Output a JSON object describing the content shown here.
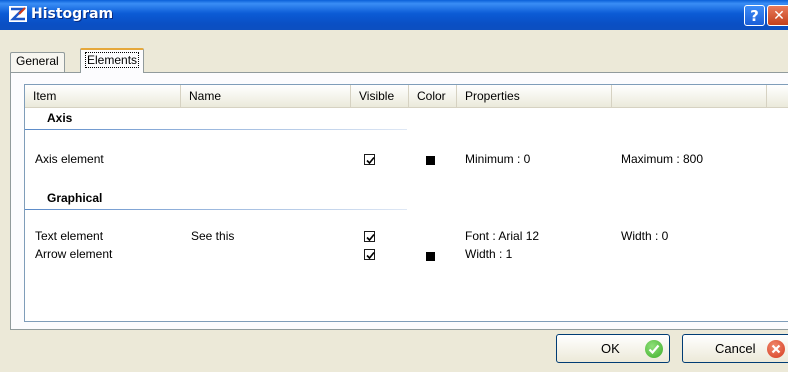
{
  "window": {
    "title": "Histogram"
  },
  "tabs": [
    {
      "label": "General"
    },
    {
      "label": "Elements"
    }
  ],
  "columns": [
    "Item",
    "Name",
    "Visible",
    "Color",
    "Properties"
  ],
  "groups": [
    {
      "label": "Axis",
      "rows": [
        {
          "item": "Axis element",
          "name": "",
          "visible": true,
          "color": "#000000",
          "prop1": "Minimum : 0",
          "prop2": "Maximum : 800"
        }
      ]
    },
    {
      "label": "Graphical",
      "rows": [
        {
          "item": "Text element",
          "name": "See this",
          "visible": true,
          "color": "",
          "prop1": "Font : Arial 12",
          "prop2": "Width : 0"
        },
        {
          "item": "Arrow element",
          "name": "",
          "visible": true,
          "color": "#000000",
          "prop1": "Width : 1",
          "prop2": ""
        }
      ]
    }
  ],
  "buttons": {
    "ok": "OK",
    "cancel": "Cancel"
  },
  "icons": {
    "app": "histogram-app-icon",
    "help": "help-icon",
    "close": "close-icon",
    "ok": "check-circle-icon",
    "cancel": "x-circle-icon",
    "check": "checkmark-icon"
  },
  "colors": {
    "titlebar": "#0a5fd8",
    "accent_tab": "#e6a83b",
    "ok_icon": "#3fae2a",
    "cancel_icon": "#d63a1f"
  }
}
